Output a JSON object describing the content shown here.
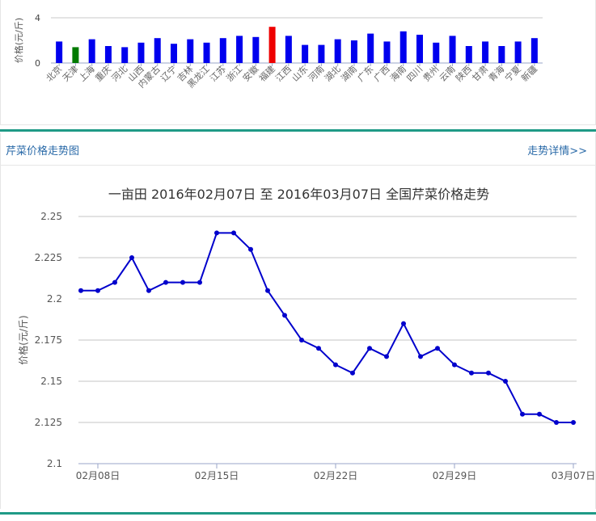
{
  "top_chart": {
    "type": "bar",
    "ylabel": "价格(元/斤)",
    "yticks": [
      0,
      4
    ],
    "ylim": [
      0,
      4
    ],
    "categories": [
      "北京",
      "天津",
      "上海",
      "重庆",
      "河北",
      "山西",
      "内蒙古",
      "辽宁",
      "吉林",
      "黑龙江",
      "江苏",
      "浙江",
      "安徽",
      "福建",
      "江西",
      "山东",
      "河南",
      "湖北",
      "湖南",
      "广东",
      "广西",
      "海南",
      "四川",
      "贵州",
      "云南",
      "陕西",
      "甘肃",
      "青海",
      "宁夏",
      "新疆"
    ],
    "values": [
      1.9,
      1.4,
      2.1,
      1.5,
      1.4,
      1.8,
      2.2,
      1.7,
      2.1,
      1.8,
      2.2,
      2.4,
      2.3,
      3.2,
      2.4,
      1.6,
      1.6,
      2.1,
      2.0,
      2.6,
      1.9,
      2.8,
      2.5,
      1.8,
      2.4,
      1.5,
      1.9,
      1.5,
      1.9,
      2.2
    ],
    "colors": [
      "#0000ee",
      "#007a00",
      "#0000ee",
      "#0000ee",
      "#0000ee",
      "#0000ee",
      "#0000ee",
      "#0000ee",
      "#0000ee",
      "#0000ee",
      "#0000ee",
      "#0000ee",
      "#0000ee",
      "#ee0000",
      "#0000ee",
      "#0000ee",
      "#0000ee",
      "#0000ee",
      "#0000ee",
      "#0000ee",
      "#0000ee",
      "#0000ee",
      "#0000ee",
      "#0000ee",
      "#0000ee",
      "#0000ee",
      "#0000ee",
      "#0000ee",
      "#0000ee",
      "#0000ee"
    ]
  },
  "section": {
    "title": "芹菜价格走势图",
    "link": "走势详情>>"
  },
  "chart_data": {
    "type": "line",
    "title": "一亩田 2016年02月07日 至 2016年03月07日 全国芹菜价格走势",
    "ylabel": "价格(元/斤)",
    "ylim": [
      2.1,
      2.25
    ],
    "yticks": [
      "2.1",
      "2.125",
      "2.15",
      "2.175",
      "2.2",
      "2.225",
      "2.25"
    ],
    "xticks": [
      {
        "day": 1,
        "label": "02月08日"
      },
      {
        "day": 8,
        "label": "02月15日"
      },
      {
        "day": 15,
        "label": "02月22日"
      },
      {
        "day": 22,
        "label": "02月29日"
      },
      {
        "day": 29,
        "label": "03月07日"
      }
    ],
    "values": [
      2.205,
      2.205,
      2.21,
      2.225,
      2.205,
      2.21,
      2.21,
      2.21,
      2.24,
      2.24,
      2.23,
      2.205,
      2.19,
      2.175,
      2.17,
      2.16,
      2.155,
      2.17,
      2.165,
      2.185,
      2.165,
      2.17,
      2.16,
      2.155,
      2.155,
      2.15,
      2.13,
      2.13,
      2.125,
      2.125
    ],
    "line_color": "#0000cc",
    "grid": true
  }
}
